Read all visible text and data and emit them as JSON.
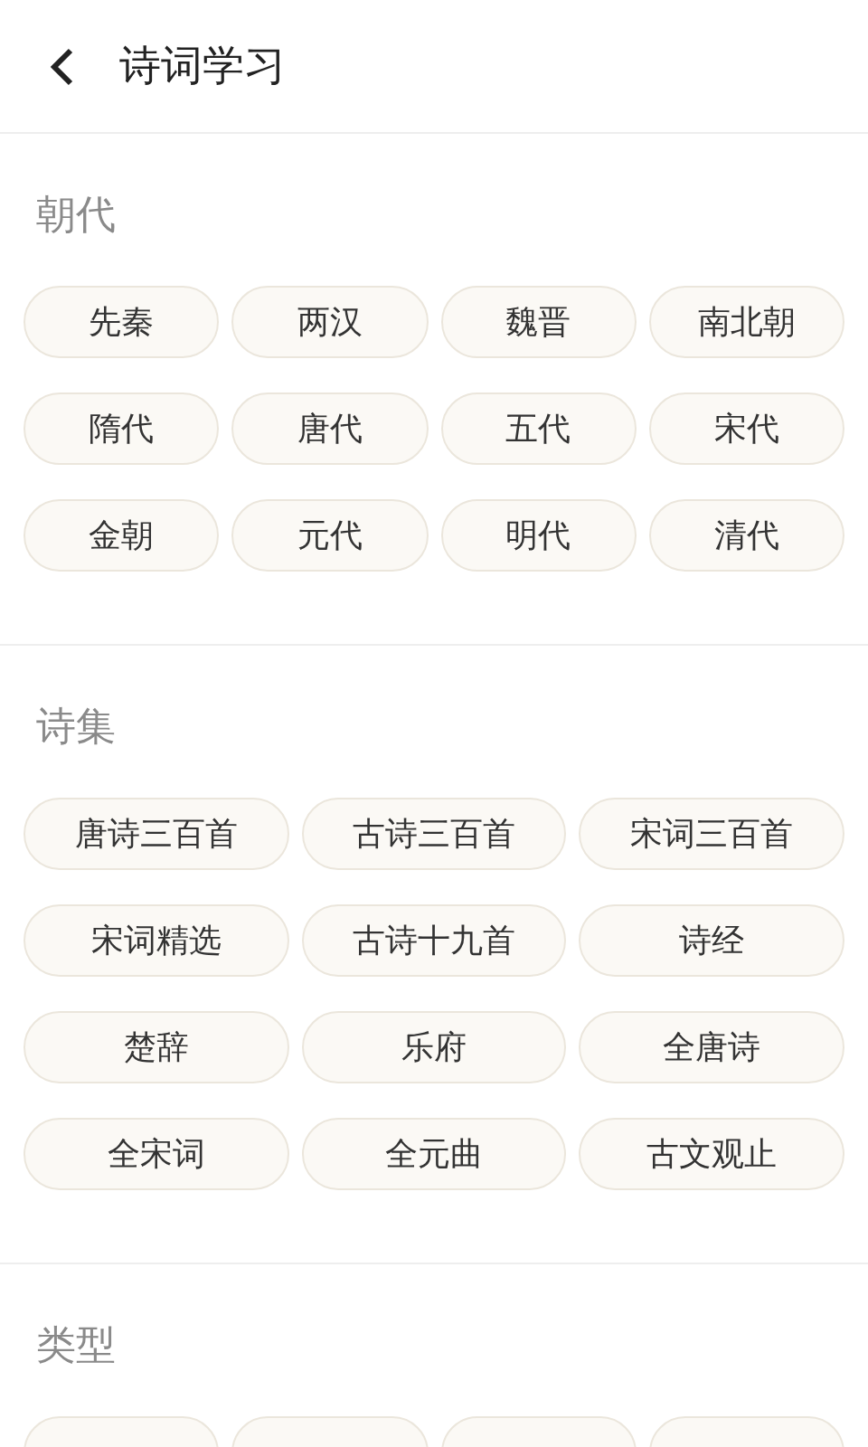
{
  "header": {
    "title": "诗词学习"
  },
  "sections": [
    {
      "kind": "short-tags",
      "title": "朝代",
      "items": [
        "先秦",
        "两汉",
        "魏晋",
        "南北朝",
        "隋代",
        "唐代",
        "五代",
        "宋代",
        "金朝",
        "元代",
        "明代",
        "清代"
      ]
    },
    {
      "kind": "long-tags",
      "title": "诗集",
      "items": [
        "唐诗三百首",
        "古诗三百首",
        "宋词三百首",
        "宋词精选",
        "古诗十九首",
        "诗经",
        "楚辞",
        "乐府",
        "全唐诗",
        "全宋词",
        "全元曲",
        "古文观止"
      ]
    },
    {
      "kind": "cut-off",
      "title": "类型"
    }
  ]
}
